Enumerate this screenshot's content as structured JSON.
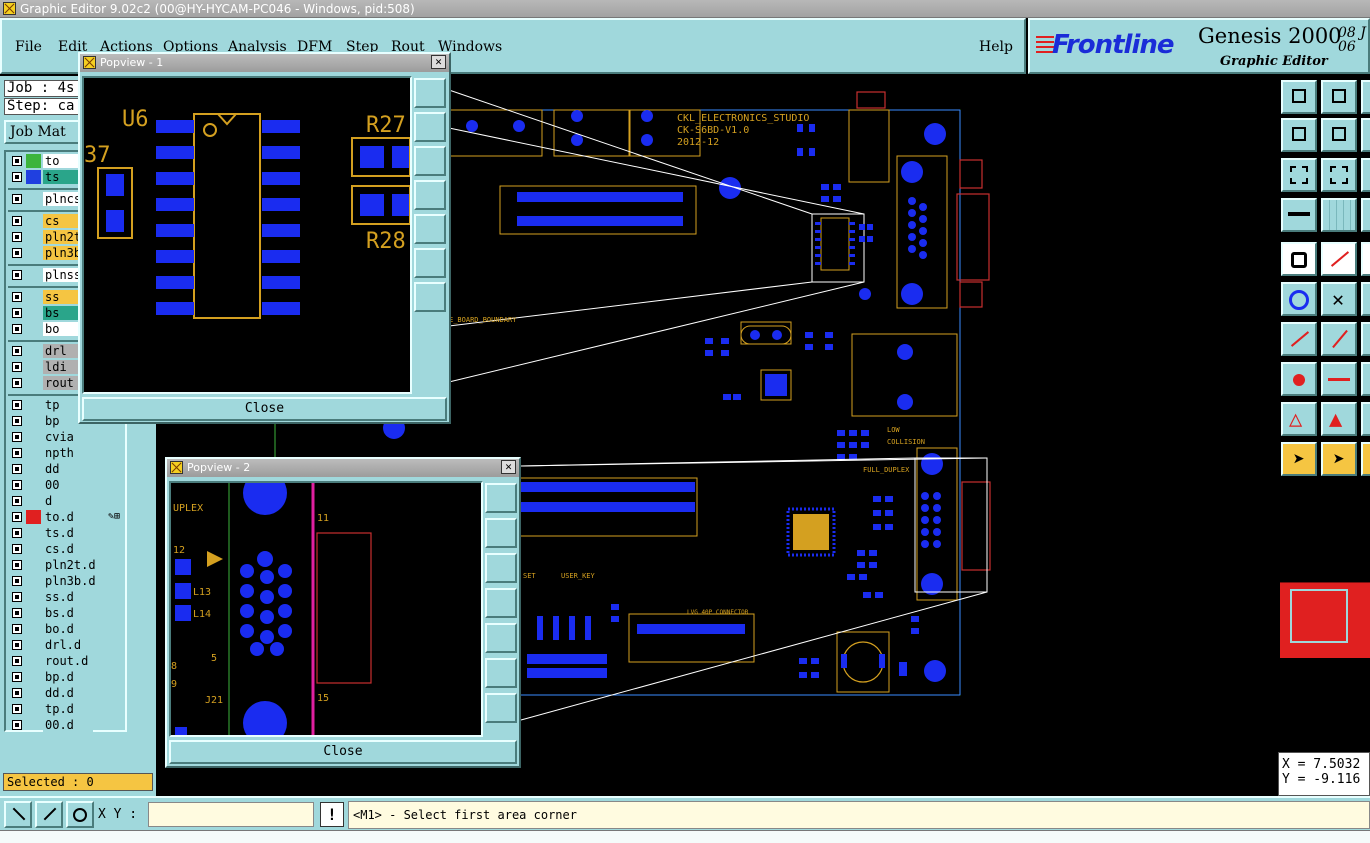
{
  "window": {
    "title": "Graphic Editor 9.02c2 (00@HY-HYCAM-PC046 - Windows, pid:508)"
  },
  "menu": {
    "file": "File",
    "edit": "Edit",
    "actions": "Actions",
    "options": "Options",
    "analysis": "Analysis",
    "dfm": "DFM",
    "step": "Step",
    "rout": "Rout",
    "windows": "Windows",
    "help": "Help"
  },
  "brand": {
    "logo": "Frontline",
    "product": "Genesis 2000",
    "version_a": "08 J",
    "version_b": "06",
    "subtitle": "Graphic Editor"
  },
  "job": {
    "job_line": "Job : 4s",
    "step_line": "Step: ca",
    "matrix_button": "Job Mat"
  },
  "layers": [
    {
      "name": "to",
      "color": "#3cb43c",
      "name_bg": "#ffffff"
    },
    {
      "name": "ts",
      "color": "#2040e0",
      "name_bg": "#2aa58a"
    },
    {
      "name": "plncs",
      "color": "",
      "name_bg": "#ffffff"
    },
    {
      "name": "cs",
      "color": "",
      "name_bg": "#f5c542"
    },
    {
      "name": "pln2t",
      "color": "",
      "name_bg": "#f5c542"
    },
    {
      "name": "pln3b",
      "color": "",
      "name_bg": "#f5c542"
    },
    {
      "name": "plnss",
      "color": "",
      "name_bg": "#ffffff"
    },
    {
      "name": "ss",
      "color": "",
      "name_bg": "#f5c542"
    },
    {
      "name": "bs",
      "color": "",
      "name_bg": "#2aa58a"
    },
    {
      "name": "bo",
      "color": "",
      "name_bg": "#ffffff"
    },
    {
      "name": "drl",
      "color": "",
      "name_bg": "#b0b0b0"
    },
    {
      "name": "ldi",
      "color": "",
      "name_bg": "#b0b0b0"
    },
    {
      "name": "rout",
      "color": "",
      "name_bg": "#b0b0b0"
    },
    {
      "name": "tp",
      "color": "",
      "name_bg": "#a0d8dc"
    },
    {
      "name": "bp",
      "color": "",
      "name_bg": "#a0d8dc"
    },
    {
      "name": "cvia",
      "color": "",
      "name_bg": "#a0d8dc"
    },
    {
      "name": "npth",
      "color": "",
      "name_bg": "#a0d8dc"
    },
    {
      "name": "dd",
      "color": "",
      "name_bg": "#a0d8dc"
    },
    {
      "name": "00",
      "color": "",
      "name_bg": "#a0d8dc"
    },
    {
      "name": "d",
      "color": "",
      "name_bg": "#a0d8dc"
    },
    {
      "name": "to.d",
      "color": "#e02020",
      "name_bg": "#a0d8dc"
    },
    {
      "name": "ts.d",
      "color": "",
      "name_bg": "#a0d8dc"
    },
    {
      "name": "cs.d",
      "color": "",
      "name_bg": "#a0d8dc"
    },
    {
      "name": "pln2t.d",
      "color": "",
      "name_bg": "#a0d8dc"
    },
    {
      "name": "pln3b.d",
      "color": "",
      "name_bg": "#a0d8dc"
    },
    {
      "name": "ss.d",
      "color": "",
      "name_bg": "#a0d8dc"
    },
    {
      "name": "bs.d",
      "color": "",
      "name_bg": "#a0d8dc"
    },
    {
      "name": "bo.d",
      "color": "",
      "name_bg": "#a0d8dc"
    },
    {
      "name": "drl.d",
      "color": "",
      "name_bg": "#a0d8dc"
    },
    {
      "name": "rout.d",
      "color": "",
      "name_bg": "#a0d8dc"
    },
    {
      "name": "bp.d",
      "color": "",
      "name_bg": "#a0d8dc"
    },
    {
      "name": "dd.d",
      "color": "",
      "name_bg": "#a0d8dc"
    },
    {
      "name": "tp.d",
      "color": "",
      "name_bg": "#a0d8dc"
    },
    {
      "name": "00.d",
      "color": "",
      "name_bg": "#a0d8dc"
    }
  ],
  "selected": "Selected : 0",
  "board_labels": {
    "studio": "CKL_ELECTRONICS_STUDIO",
    "board": "CK-S6BD-V1.0",
    "date": "2012-12",
    "boundary": "E_BOARD_BOUNDARY",
    "collision": "COLLISION",
    "full_duplex": "FULL_DUPLEX",
    "low": "LOW",
    "user_key": "USER_KEY",
    "reset": "SET",
    "connector": "LVG 40P CONNECTOR"
  },
  "popview1": {
    "title": "Popview - 1",
    "close_label": "Close",
    "labels": {
      "u6": "U6",
      "r27": "R27",
      "r28": "R28",
      "l37": "37"
    }
  },
  "popview2": {
    "title": "Popview - 2",
    "close_label": "Close",
    "labels": {
      "duplex": "UPLEX",
      "l12": "12",
      "l13": "L13",
      "l14": "L14",
      "j21": "J21",
      "p5": "5",
      "p8": "8",
      "p9": "9",
      "p11": "11",
      "p15": "15"
    }
  },
  "coords": {
    "x": "X = 7.5032",
    "y": "Y = -9.116"
  },
  "bottom": {
    "xy_label": "X Y :",
    "xy_value": "",
    "bang": "!",
    "prompt": "<M1> - Select first area corner"
  },
  "colors": {
    "panel": "#a0d8dc",
    "copper": "#d4a020",
    "pad": "#1a2cf0",
    "outline": "#3cb43c",
    "accent_red": "#e02020"
  }
}
